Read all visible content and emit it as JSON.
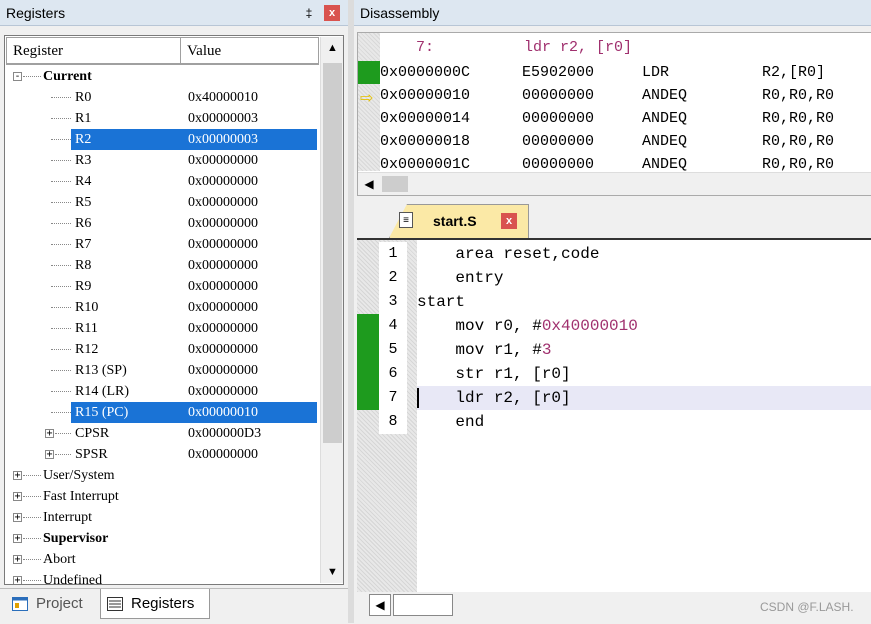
{
  "registers_panel": {
    "title": "Registers",
    "pin": "‡",
    "close": "x",
    "col_register": "Register",
    "col_value": "Value",
    "current_label": "Current",
    "rows": [
      {
        "name": "R0",
        "value": "0x40000010"
      },
      {
        "name": "R1",
        "value": "0x00000003"
      },
      {
        "name": "R2",
        "value": "0x00000003"
      },
      {
        "name": "R3",
        "value": "0x00000000"
      },
      {
        "name": "R4",
        "value": "0x00000000"
      },
      {
        "name": "R5",
        "value": "0x00000000"
      },
      {
        "name": "R6",
        "value": "0x00000000"
      },
      {
        "name": "R7",
        "value": "0x00000000"
      },
      {
        "name": "R8",
        "value": "0x00000000"
      },
      {
        "name": "R9",
        "value": "0x00000000"
      },
      {
        "name": "R10",
        "value": "0x00000000"
      },
      {
        "name": "R11",
        "value": "0x00000000"
      },
      {
        "name": "R12",
        "value": "0x00000000"
      },
      {
        "name": "R13 (SP)",
        "value": "0x00000000"
      },
      {
        "name": "R14 (LR)",
        "value": "0x00000000"
      },
      {
        "name": "R15 (PC)",
        "value": "0x00000010"
      },
      {
        "name": "CPSR",
        "value": "0x000000D3"
      },
      {
        "name": "SPSR",
        "value": "0x00000000"
      }
    ],
    "groups": [
      "User/System",
      "Fast Interrupt",
      "Interrupt",
      "Supervisor",
      "Abort",
      "Undefined"
    ]
  },
  "bottom_tabs": {
    "project": "Project",
    "registers": "Registers"
  },
  "disassembly": {
    "title": "Disassembly",
    "source_line": "    7:          ldr r2, [r0]",
    "lines": [
      {
        "addr": "0x0000000C",
        "code": "E5902000",
        "mnem": "LDR",
        "ops": "R2,[R0]"
      },
      {
        "addr": "0x00000010",
        "code": "00000000",
        "mnem": "ANDEQ",
        "ops": "R0,R0,R0"
      },
      {
        "addr": "0x00000014",
        "code": "00000000",
        "mnem": "ANDEQ",
        "ops": "R0,R0,R0"
      },
      {
        "addr": "0x00000018",
        "code": "00000000",
        "mnem": "ANDEQ",
        "ops": "R0,R0,R0"
      },
      {
        "addr": "0x0000001C",
        "code": "00000000",
        "mnem": "ANDEQ",
        "ops": "R0,R0,R0"
      }
    ]
  },
  "editor": {
    "tab_label": "start.S",
    "lines": [
      {
        "n": "1",
        "pre": "    area reset,code",
        "num": ""
      },
      {
        "n": "2",
        "pre": "    entry",
        "num": ""
      },
      {
        "n": "3",
        "pre": "start",
        "num": ""
      },
      {
        "n": "4",
        "pre": "    mov r0, #",
        "num": "0x40000010"
      },
      {
        "n": "5",
        "pre": "    mov r1, #",
        "num": "3"
      },
      {
        "n": "6",
        "pre": "    str r1, [r0]",
        "num": ""
      },
      {
        "n": "7",
        "pre": "    ldr r2, [r0]",
        "num": ""
      },
      {
        "n": "8",
        "pre": "    end",
        "num": ""
      }
    ]
  },
  "watermark": "CSDN @F.LASH.",
  "colors": {
    "selection": "#1a73d6",
    "breakpoint_green": "#1e9b1e",
    "immediate": "#a0306e"
  }
}
